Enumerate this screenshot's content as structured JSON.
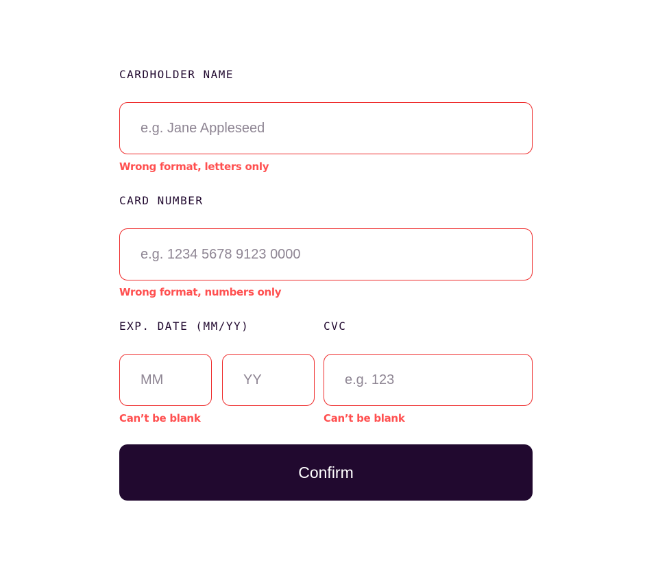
{
  "form": {
    "cardholder": {
      "label": "CARDHOLDER NAME",
      "placeholder": "e.g. Jane Appleseed",
      "value": "",
      "error": "Wrong format, letters only"
    },
    "card_number": {
      "label": "CARD NUMBER",
      "placeholder": "e.g. 1234 5678 9123 0000",
      "value": "",
      "error": "Wrong format, numbers only"
    },
    "exp_date": {
      "label": "EXP. DATE (MM/YY)",
      "month_placeholder": "MM",
      "year_placeholder": "YY",
      "error": "Can’t be blank"
    },
    "cvc": {
      "label": "CVC",
      "placeholder": "e.g. 123",
      "error": "Can’t be blank"
    },
    "confirm_label": "Confirm"
  },
  "colors": {
    "text_dark": "#21092f",
    "error": "#ff5050",
    "input_error_border": "#ee2a2a",
    "placeholder": "#8e8593",
    "button_bg": "#21092f",
    "button_text": "#ffffff"
  }
}
